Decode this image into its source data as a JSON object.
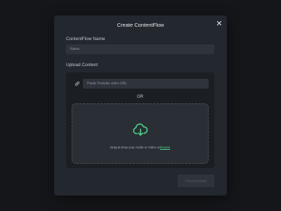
{
  "modal": {
    "title": "Create ContentFlow",
    "close_icon": "close-icon"
  },
  "name_field": {
    "label": "ContentFlow Name",
    "placeholder": "Name",
    "value": ""
  },
  "upload": {
    "label": "Upload Content",
    "link_icon": "link-icon",
    "url_placeholder": "Paste Youtube video URL",
    "url_value": "",
    "or_text": "OR",
    "upload_icon": "cloud-upload-icon",
    "drop_text": "Drag & Drop your Audio or Video or",
    "browse_label": "browse"
  },
  "actions": {
    "transform_label": "TRANSFORM"
  },
  "colors": {
    "background": "#141619",
    "modal": "#23272e",
    "accent": "#4fd28a"
  }
}
